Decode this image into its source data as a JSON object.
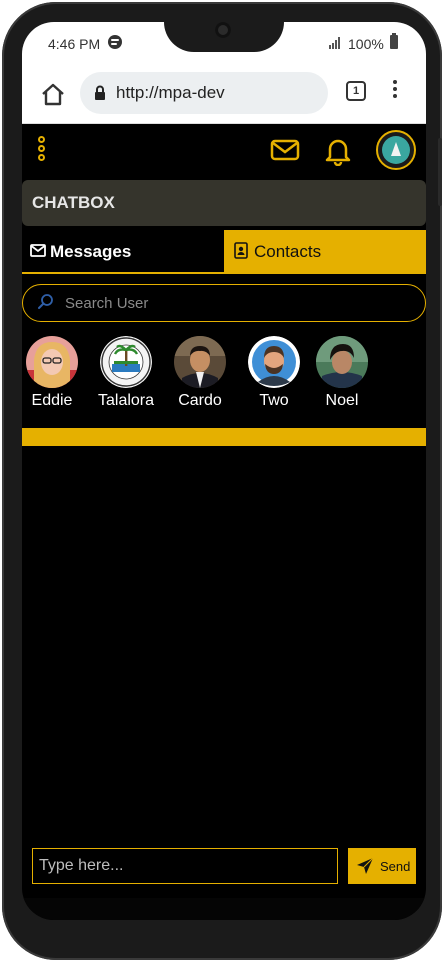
{
  "status_bar": {
    "time": "4:46 PM",
    "battery": "100%"
  },
  "browser": {
    "url": "http://mpa-dev",
    "tab_count": "1"
  },
  "app": {
    "header_title": "CHATBOX"
  },
  "tabs": [
    {
      "label": "Messages",
      "active": false
    },
    {
      "label": "Contacts",
      "active": true
    }
  ],
  "search": {
    "placeholder": "Search User"
  },
  "contacts": [
    {
      "name": "Eddie"
    },
    {
      "name": "Talalora"
    },
    {
      "name": "Cardo"
    },
    {
      "name": "Two"
    },
    {
      "name": "Noel"
    }
  ],
  "composer": {
    "placeholder": "Type here...",
    "send_label": "Send"
  },
  "colors": {
    "accent": "#e5b000",
    "background": "#000000",
    "header_bar": "#35342c"
  }
}
